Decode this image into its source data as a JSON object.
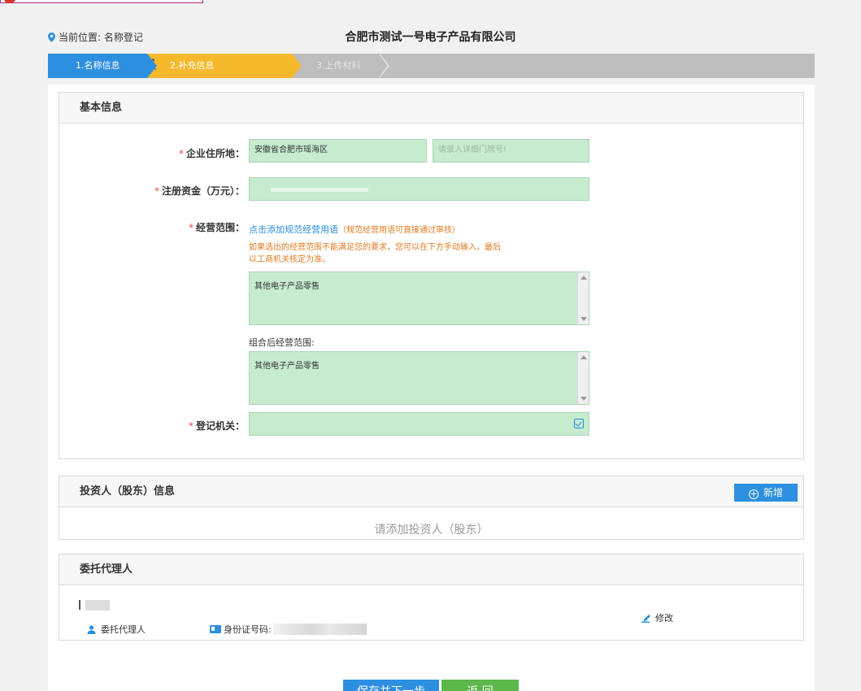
{
  "header": {
    "location_label": "当前位置: 名称登记",
    "company_name": "合肥市测试一号电子产品有限公司"
  },
  "steps": [
    {
      "label": "1.名称信息"
    },
    {
      "label": "2.补充信息"
    },
    {
      "label": "3.上传材料"
    }
  ],
  "basic_info": {
    "title": "基本信息",
    "address_label": "企业住所地：",
    "address_value": "安徽省合肥市瑶海区",
    "address_detail_placeholder": "请录入详细门牌号!",
    "capital_label": "注册资金（万元）：",
    "scope_label": "经营范围：",
    "scope_link": "点击添加规范经营用语",
    "scope_link_note": "（规范经营用语可直接通过审核）",
    "scope_hint": "如果选出的经营范围不能满足您的要求，您可以在下方手动输入，最后以工商机关核定为准。",
    "scope_manual_value": "其他电子产品零售",
    "combined_scope_label": "组合后经营范围:",
    "combined_scope_value": "其他电子产品零售",
    "authority_label": "登记机关："
  },
  "investors": {
    "title": "投资人（股东）信息",
    "add_button": "新增",
    "empty_hint": "请添加投资人（股东）"
  },
  "agent": {
    "title": "委托代理人",
    "role": "委托代理人",
    "id_label": "身份证号码:",
    "modify": "修改"
  },
  "actions": {
    "save_next": "保存并下一步",
    "back": "返 回"
  },
  "colors": {
    "accent_blue": "#2d8fe0",
    "step_orange": "#f6b92c",
    "field_green": "#c6ebcf",
    "back_green": "#5cb84a",
    "required_red": "#e44",
    "hint_orange": "#e07a1f"
  }
}
